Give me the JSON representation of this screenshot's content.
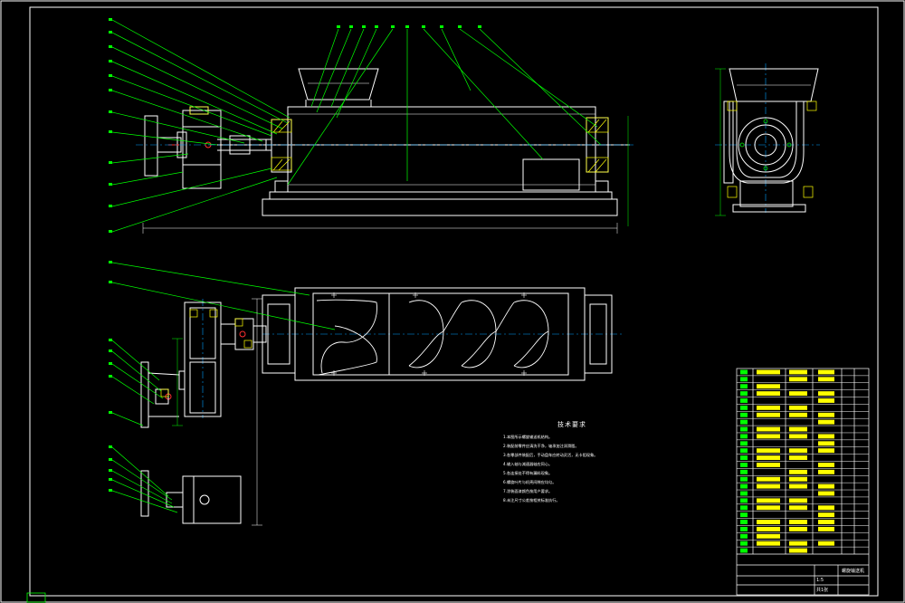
{
  "technical_requirements": {
    "title": "技术要求",
    "lines": [
      "1.本图所示螺旋输送机结构。",
      "2.装配前零件应清洗干净，轴承加注润滑脂。",
      "3.各零部件装配后，手动盘车应转动灵活，无卡阻现象。",
      "4.输入轴与减速器轴应同心。",
      "5.各连接处不得有漏料现象。",
      "6.螺旋叶片与机壳间隙应均匀。",
      "7.涂装面漆颜色按用户要求。",
      "8.未注尺寸公差按相关标准执行。"
    ]
  },
  "title_block": {
    "drawing_name": "螺旋输送机",
    "scale": "1:5",
    "sheet": "共1张"
  },
  "colors": {
    "background": "#000000",
    "outline": "#ffffff",
    "leader": "#00ff00",
    "hatch": "#ffff00",
    "dimension": "#00ffff",
    "centerline": "#00a0ff",
    "accent": "#ff3030"
  }
}
